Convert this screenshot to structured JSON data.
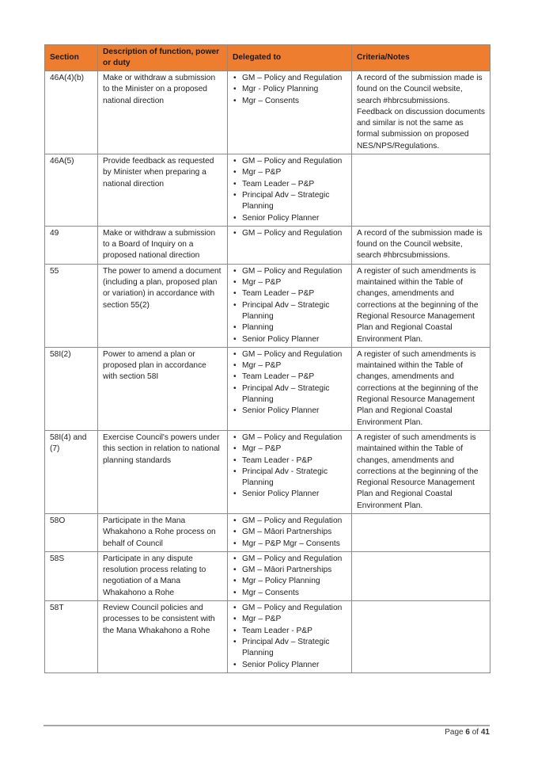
{
  "table": {
    "header_color": "#ef7d2f",
    "headers": [
      "Section",
      "Description of function, power or duty",
      "Delegated to",
      "Criteria/Notes"
    ],
    "rows": [
      {
        "section": "46A(4)(b)",
        "description": "Make or withdraw a submission to the Minister on a proposed national direction",
        "delegates": [
          "GM – Policy and Regulation",
          "Mgr - Policy Planning",
          "Mgr – Consents"
        ],
        "notes": "A record of the submission made is found on the Council website, search #hbrcsubmissions. Feedback on discussion documents and similar is not the same as formal submission on proposed NES/NPS/Regulations."
      },
      {
        "section": "46A(5)",
        "description": "Provide feedback as requested by Minister when preparing a national direction",
        "delegates": [
          "GM – Policy and Regulation",
          "Mgr – P&P",
          "Team Leader – P&P",
          "Principal Adv – Strategic Planning",
          "Senior Policy Planner"
        ],
        "notes": ""
      },
      {
        "section": "49",
        "description": "Make or withdraw a submission to a Board of Inquiry on a proposed national direction",
        "delegates": [
          "GM – Policy and Regulation"
        ],
        "notes": "A record of the submission made is found on the Council website, search #hbrcsubmissions."
      },
      {
        "section": "55",
        "description": "The power to amend a document (including a plan, proposed plan or variation) in accordance with section 55(2)",
        "delegates": [
          "GM – Policy and Regulation",
          "Mgr – P&P",
          "Team Leader – P&P",
          "Principal Adv – Strategic Planning",
          "Planning",
          "Senior Policy Planner"
        ],
        "notes": "A register of such amendments is maintained within the Table of changes, amendments and corrections at the beginning of the Regional Resource Management Plan and Regional Coastal Environment Plan."
      },
      {
        "section": "58I(2)",
        "description": "Power to amend a plan or proposed plan in accordance with section 58I",
        "delegates": [
          "GM – Policy and Regulation",
          "Mgr – P&P",
          "Team Leader – P&P",
          "Principal Adv – Strategic Planning",
          "Senior Policy Planner"
        ],
        "notes": "A register of such amendments is maintained within the Table of changes, amendments and corrections at the beginning of the Regional Resource Management Plan and Regional Coastal Environment Plan."
      },
      {
        "section": "58I(4) and (7)",
        "description": "Exercise Council's powers under this section in relation to national planning standards",
        "delegates": [
          "GM – Policy and Regulation",
          "Mgr – P&P",
          "Team Leader - P&P",
          "Principal Adv -  Strategic Planning",
          "Senior Policy Planner"
        ],
        "notes": "A register of such amendments is maintained within the Table of changes, amendments and corrections at the beginning of the Regional Resource Management Plan and Regional Coastal Environment Plan."
      },
      {
        "section": "58O",
        "description": "Participate in the Mana Whakahono a Rohe process on behalf of Council",
        "delegates": [
          "GM – Policy and Regulation",
          "GM – Māori Partnerships",
          "Mgr – P&P Mgr – Consents"
        ],
        "notes": ""
      },
      {
        "section": "58S",
        "description": "Participate in any dispute resolution process relating to negotiation of a Mana Whakahono a Rohe",
        "delegates": [
          "GM – Policy and Regulation",
          "GM – Māori Partnerships",
          "Mgr – Policy Planning",
          "Mgr – Consents"
        ],
        "notes": ""
      },
      {
        "section": "58T",
        "description": "Review Council policies and processes to be consistent with the Mana Whakahono a Rohe",
        "delegates": [
          "GM – Policy and Regulation",
          "Mgr – P&P",
          "Team Leader - P&P",
          "Principal Adv – Strategic Planning",
          "Senior Policy Planner"
        ],
        "notes": ""
      }
    ]
  },
  "footer": {
    "page_prefix": "Page ",
    "page_current": "6",
    "page_of": " of ",
    "page_total": "41"
  }
}
